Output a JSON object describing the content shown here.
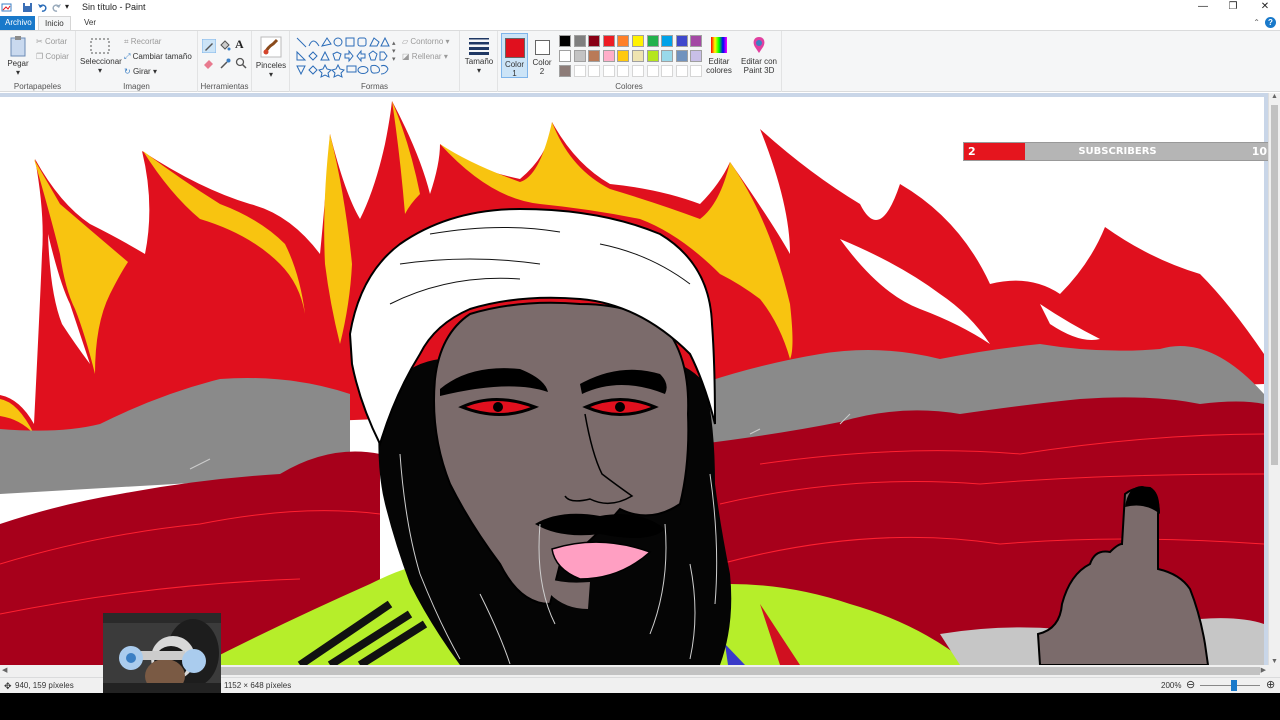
{
  "window": {
    "title": "Sin título - Paint",
    "controls": {
      "minimize": "—",
      "restore": "❐",
      "close": "✕"
    }
  },
  "tabs": [
    "Archivo",
    "Inicio",
    "Ver"
  ],
  "ribbon": {
    "portapapeles": {
      "label": "Portapapeles",
      "pegar": "Pegar",
      "cortar": "Cortar",
      "copiar": "Copiar"
    },
    "imagen": {
      "label": "Imagen",
      "seleccionar": "Seleccionar",
      "recortar": "Recortar",
      "cambiar_tamano": "Cambiar tamaño",
      "girar": "Girar"
    },
    "herramientas": {
      "label": "Herramientas"
    },
    "pinceles": {
      "label": "Pinceles"
    },
    "formas": {
      "label": "Formas",
      "contorno": "Contorno",
      "rellenar": "Rellenar"
    },
    "tamano": {
      "label": "Tamaño"
    },
    "color1": {
      "label": "Color",
      "num": "1",
      "value": "#e0101e"
    },
    "color2": {
      "label": "Color",
      "num": "2",
      "value": "#ffffff"
    },
    "colores": {
      "label": "Colores",
      "palette_row1": [
        "#000000",
        "#7f7f7f",
        "#880015",
        "#ed1c24",
        "#ff7f27",
        "#fff200",
        "#22b14c",
        "#00a2e8",
        "#3f48cc",
        "#a349a4"
      ],
      "palette_row2": [
        "#ffffff",
        "#c3c3c3",
        "#b97a57",
        "#ffaec9",
        "#ffc90e",
        "#efe4b0",
        "#b5e61d",
        "#99d9ea",
        "#7092be",
        "#c8bfe7"
      ],
      "palette_row3": [
        "#8d7c78",
        "#ffffff",
        "#ffffff",
        "#ffffff",
        "#ffffff",
        "#ffffff",
        "#ffffff",
        "#ffffff",
        "#ffffff",
        "#ffffff"
      ],
      "editar_colores": "Editar colores",
      "editar_paint3d": "Editar con Paint 3D"
    }
  },
  "overlay": {
    "subscribers_label": "SUBSCRIBERS",
    "subscribers_current": "2",
    "subscribers_goal": "10",
    "progress": 0.2
  },
  "status": {
    "cursor": "940, 159 píxeles",
    "size": "1152 × 648 píxeles",
    "zoom": "200%"
  }
}
